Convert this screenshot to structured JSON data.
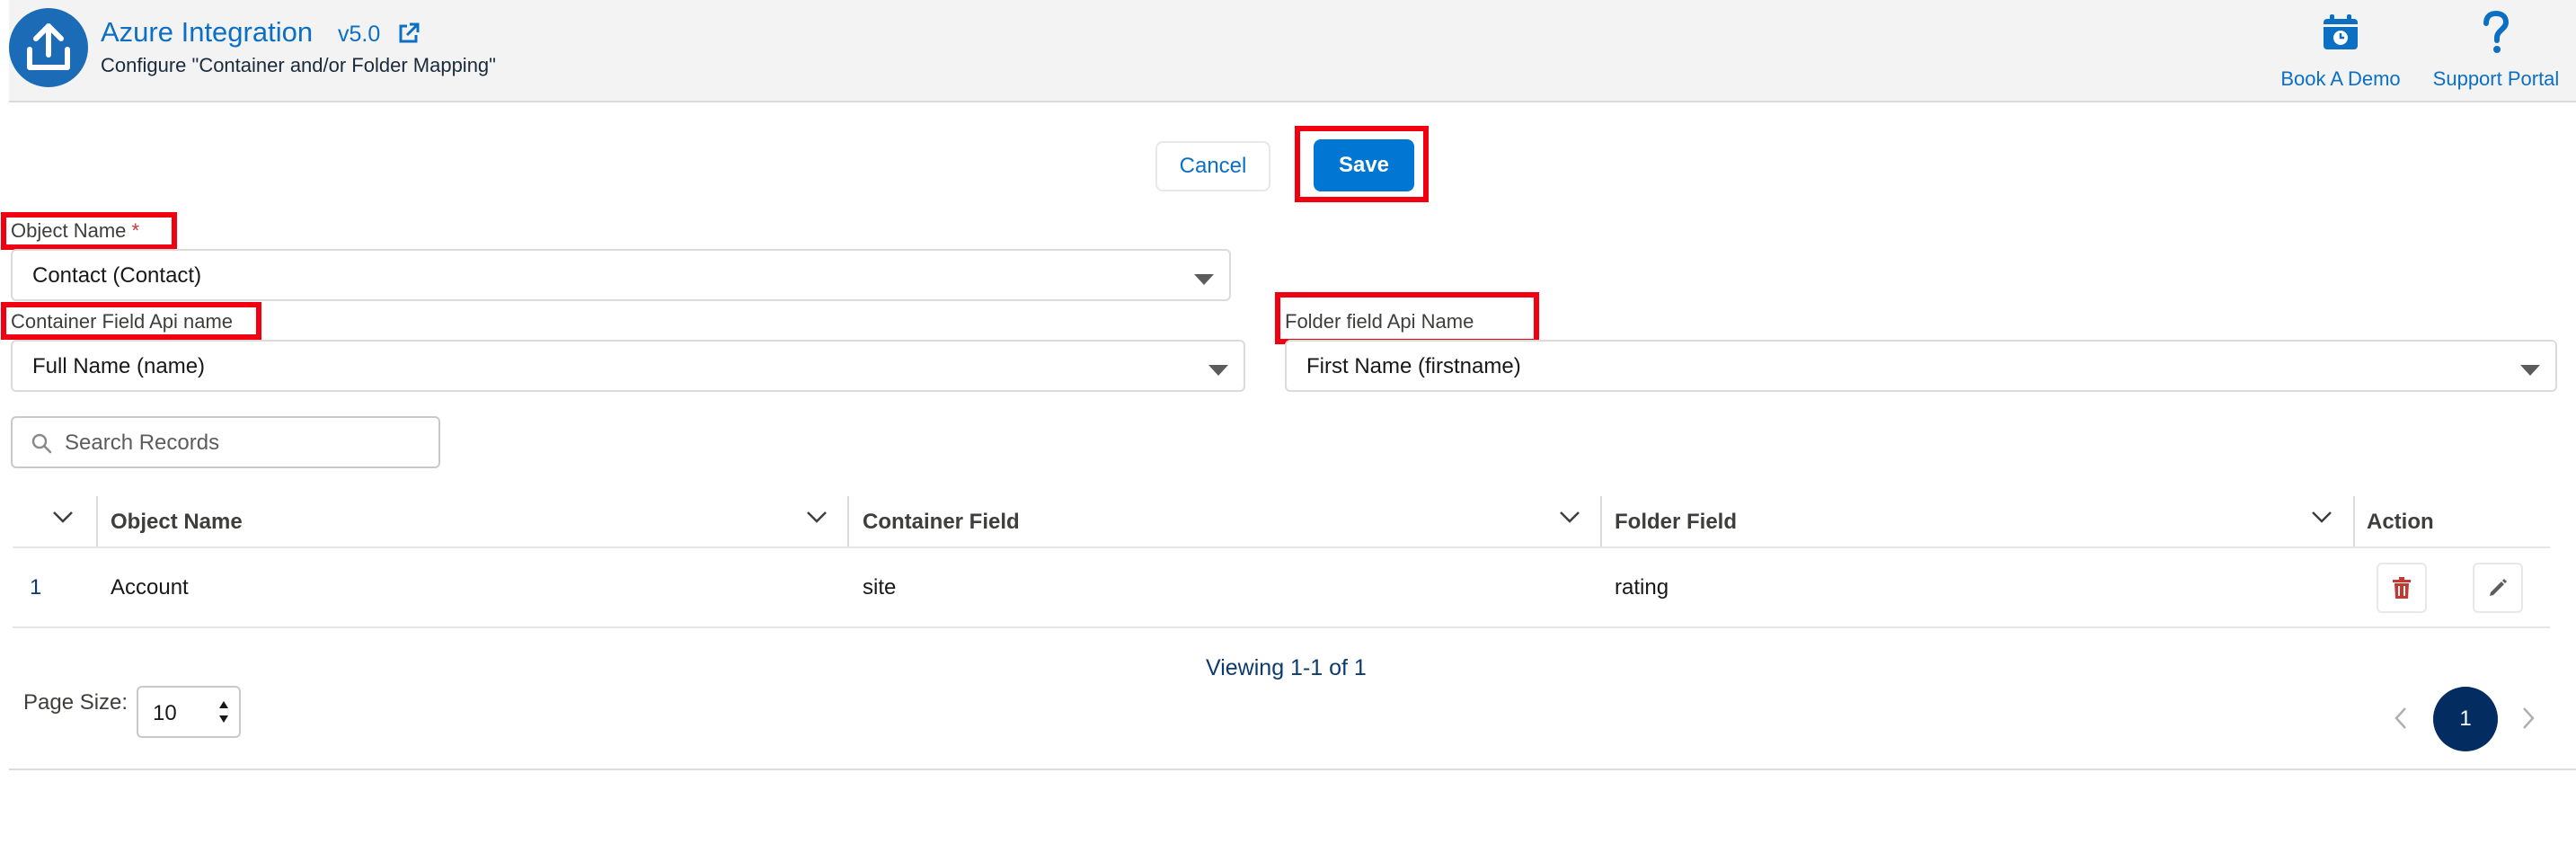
{
  "header": {
    "title": "Azure Integration",
    "version": "v5.0",
    "subtitle": "Configure \"Container and/or Folder Mapping\"",
    "book_demo": "Book A Demo",
    "support_portal": "Support Portal"
  },
  "actions": {
    "cancel": "Cancel",
    "save": "Save"
  },
  "form": {
    "object_name": {
      "label": "Object Name",
      "required_mark": "*",
      "value": "Contact (Contact)"
    },
    "container_field": {
      "label": "Container Field Api name",
      "value": "Full Name (name)"
    },
    "folder_field": {
      "label": "Folder field Api Name",
      "value": "First Name (firstname)"
    }
  },
  "search": {
    "placeholder": "Search Records",
    "value": ""
  },
  "table": {
    "columns": [
      "Object Name",
      "Container Field",
      "Folder Field",
      "Action"
    ],
    "rows": [
      {
        "index": "1",
        "object_name": "Account",
        "container_field": "site",
        "folder_field": "rating"
      }
    ]
  },
  "pagination": {
    "viewing": "Viewing 1-1 of 1",
    "page_size_label": "Page Size:",
    "page_size": "10",
    "current_page": "1"
  },
  "colors": {
    "brand": "#0176d3",
    "link": "#0b6fc4",
    "highlight": "#f00010",
    "delete": "#c23934",
    "page_active": "#032d60"
  },
  "icons": [
    "upload-icon",
    "external-link-icon",
    "calendar-icon",
    "question-icon",
    "caret-down-icon",
    "search-icon",
    "chevron-down-icon",
    "trash-icon",
    "pencil-icon",
    "chevron-left-icon",
    "chevron-right-icon",
    "spinner-arrows-icon"
  ]
}
